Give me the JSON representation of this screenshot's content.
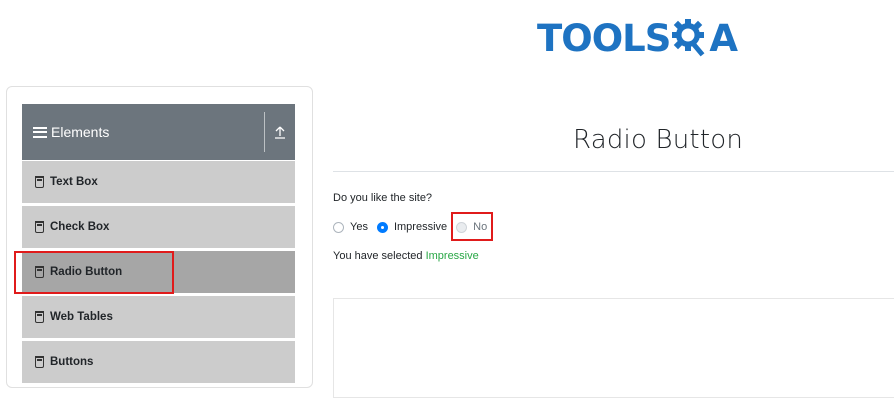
{
  "logo": {
    "text_left": "TOOLS",
    "text_right": "A",
    "brand_color": "#1e73c2"
  },
  "sidebar": {
    "group": {
      "label": "Elements",
      "icon": "hamburger-icon",
      "toggle_icon": "upload-arrow-icon"
    },
    "items": [
      {
        "label": "Text Box",
        "icon": "form-icon",
        "active": false
      },
      {
        "label": "Check Box",
        "icon": "form-icon",
        "active": false
      },
      {
        "label": "Radio Button",
        "icon": "form-icon",
        "active": true
      },
      {
        "label": "Web Tables",
        "icon": "form-icon",
        "active": false
      },
      {
        "label": "Buttons",
        "icon": "form-icon",
        "active": false
      }
    ]
  },
  "main": {
    "title": "Radio Button",
    "question": "Do you like the site?",
    "options": [
      {
        "label": "Yes",
        "checked": false,
        "disabled": false
      },
      {
        "label": "Impressive",
        "checked": true,
        "disabled": false
      },
      {
        "label": "No",
        "checked": false,
        "disabled": true
      }
    ],
    "result_prefix": "You have selected",
    "result_value": "Impressive"
  },
  "colors": {
    "accent": "#007bff",
    "success": "#28a745",
    "highlight": "#e01b1b",
    "header_bg": "#6c757d",
    "menu_bg": "#cccccc",
    "menu_active_bg": "#a6a6a6"
  }
}
